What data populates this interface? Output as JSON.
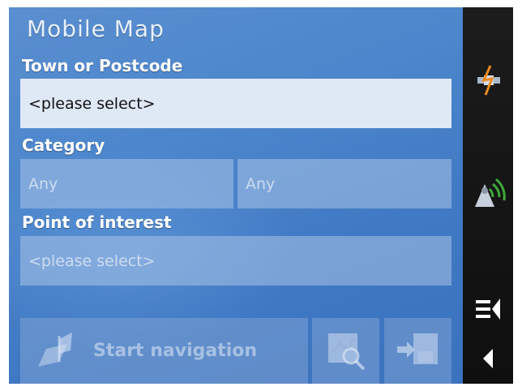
{
  "app": {
    "title": "Mobile Map"
  },
  "form": {
    "town_label": "Town or Postcode",
    "town_value": "<please select>",
    "category_label": "Category",
    "category_value_1": "Any",
    "category_value_2": "Any",
    "poi_label": "Point of interest",
    "poi_value": "<please select>"
  },
  "actions": {
    "start_navigation_label": "Start navigation",
    "search_map_icon": "map-search-icon",
    "save_icon": "save-to-disk-icon"
  },
  "sidebar": {
    "icons": [
      "satellite-dish-icon",
      "gps-signal-icon",
      "menu-collapse-icon",
      "back-arrow-icon"
    ]
  },
  "colors": {
    "panel_blue": "#4c86cc",
    "sidebar_dark": "#151515",
    "field_active": "#dfe8f5",
    "accent_orange": "#f08a1c"
  }
}
